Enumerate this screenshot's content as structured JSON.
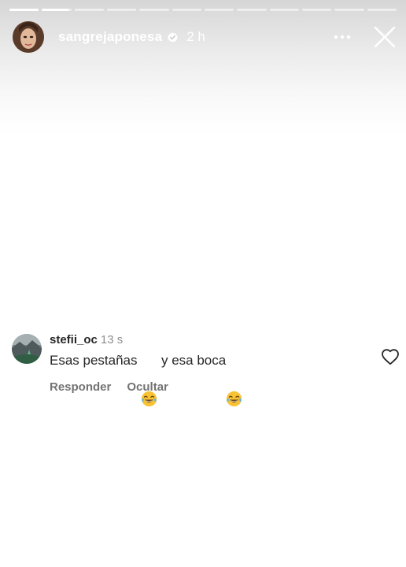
{
  "story": {
    "progress_segments": [
      1,
      0.9,
      0,
      0,
      0,
      0,
      0,
      0,
      0,
      0,
      0,
      0
    ],
    "username": "sangrejaponesa",
    "time": "2 h",
    "verified": true,
    "icons": {
      "avatar": "avatar-icon",
      "verified": "verified-badge-icon",
      "more": "more-horizontal-icon",
      "close": "close-icon"
    }
  },
  "comment": {
    "username": "stefii_oc",
    "time": "13 s",
    "text_part1": "Esas pestañas ",
    "text_part2": " y esa boca",
    "emoji": "face-with-tears-of-joy",
    "reply_label": "Responder",
    "hide_label": "Ocultar",
    "icons": {
      "avatar": "avatar-icon",
      "like": "heart-outline-icon"
    }
  },
  "colors": {
    "text_primary": "#262626",
    "text_secondary": "#737373",
    "timestamp": "#8e8e8e",
    "header_text": "#ffffff"
  }
}
